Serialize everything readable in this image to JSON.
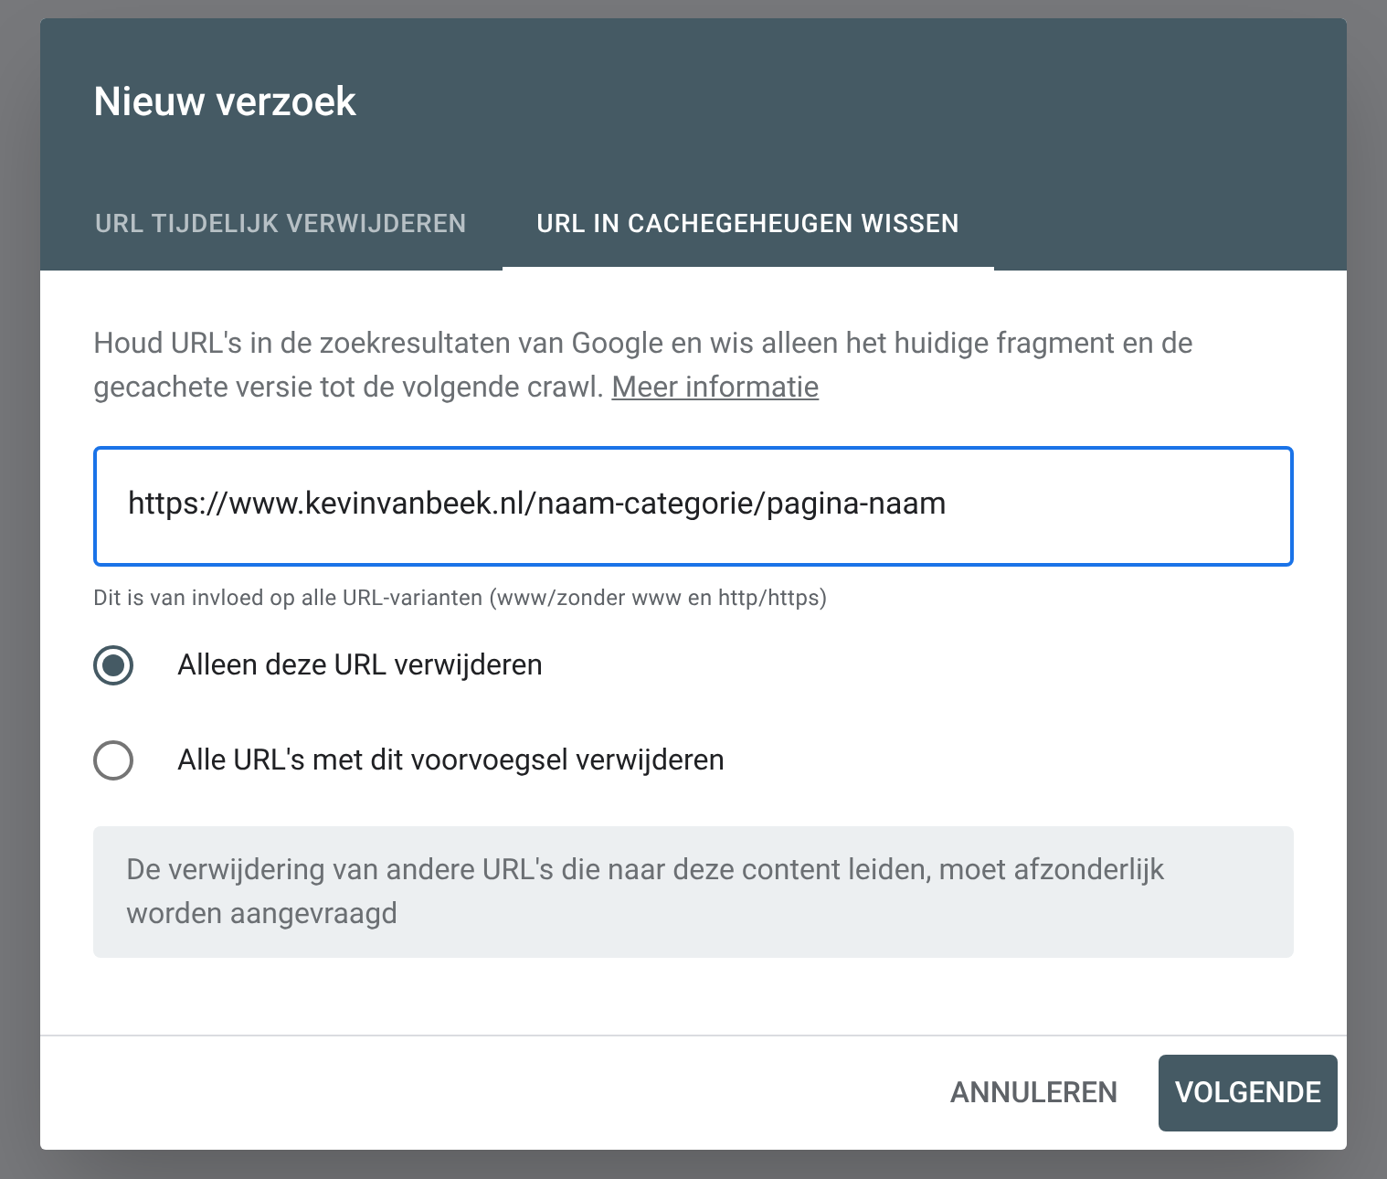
{
  "dialog": {
    "title": "Nieuw verzoek",
    "tabs": [
      {
        "label": "URL TIJDELIJK VERWIJDEREN",
        "selected": false
      },
      {
        "label": "URL IN CACHEGEHEUGEN WISSEN",
        "selected": true
      }
    ],
    "description": "Houd URL's in de zoekresultaten van Google en wis alleen het huidige fragment en de gecachete versie tot de volgende crawl.",
    "link": "Meer informatie",
    "url_field": {
      "value": "https://www.kevinvanbeek.nl/naam-categorie/pagina-naam",
      "helper": "Dit is van invloed op alle URL-varianten (www/zonder www en http/https)"
    },
    "options": [
      {
        "label": "Alleen deze URL verwijderen",
        "selected": true
      },
      {
        "label": "Alle URL's met dit voorvoegsel verwijderen",
        "selected": false
      }
    ],
    "notice": "De verwijdering van andere URL's die naar deze content leiden, moet afzonderlijk worden aangevraagd",
    "buttons": [
      {
        "label": "ANNULEREN",
        "kind": "text"
      },
      {
        "label": "VOLGENDE",
        "kind": "primary"
      }
    ]
  }
}
